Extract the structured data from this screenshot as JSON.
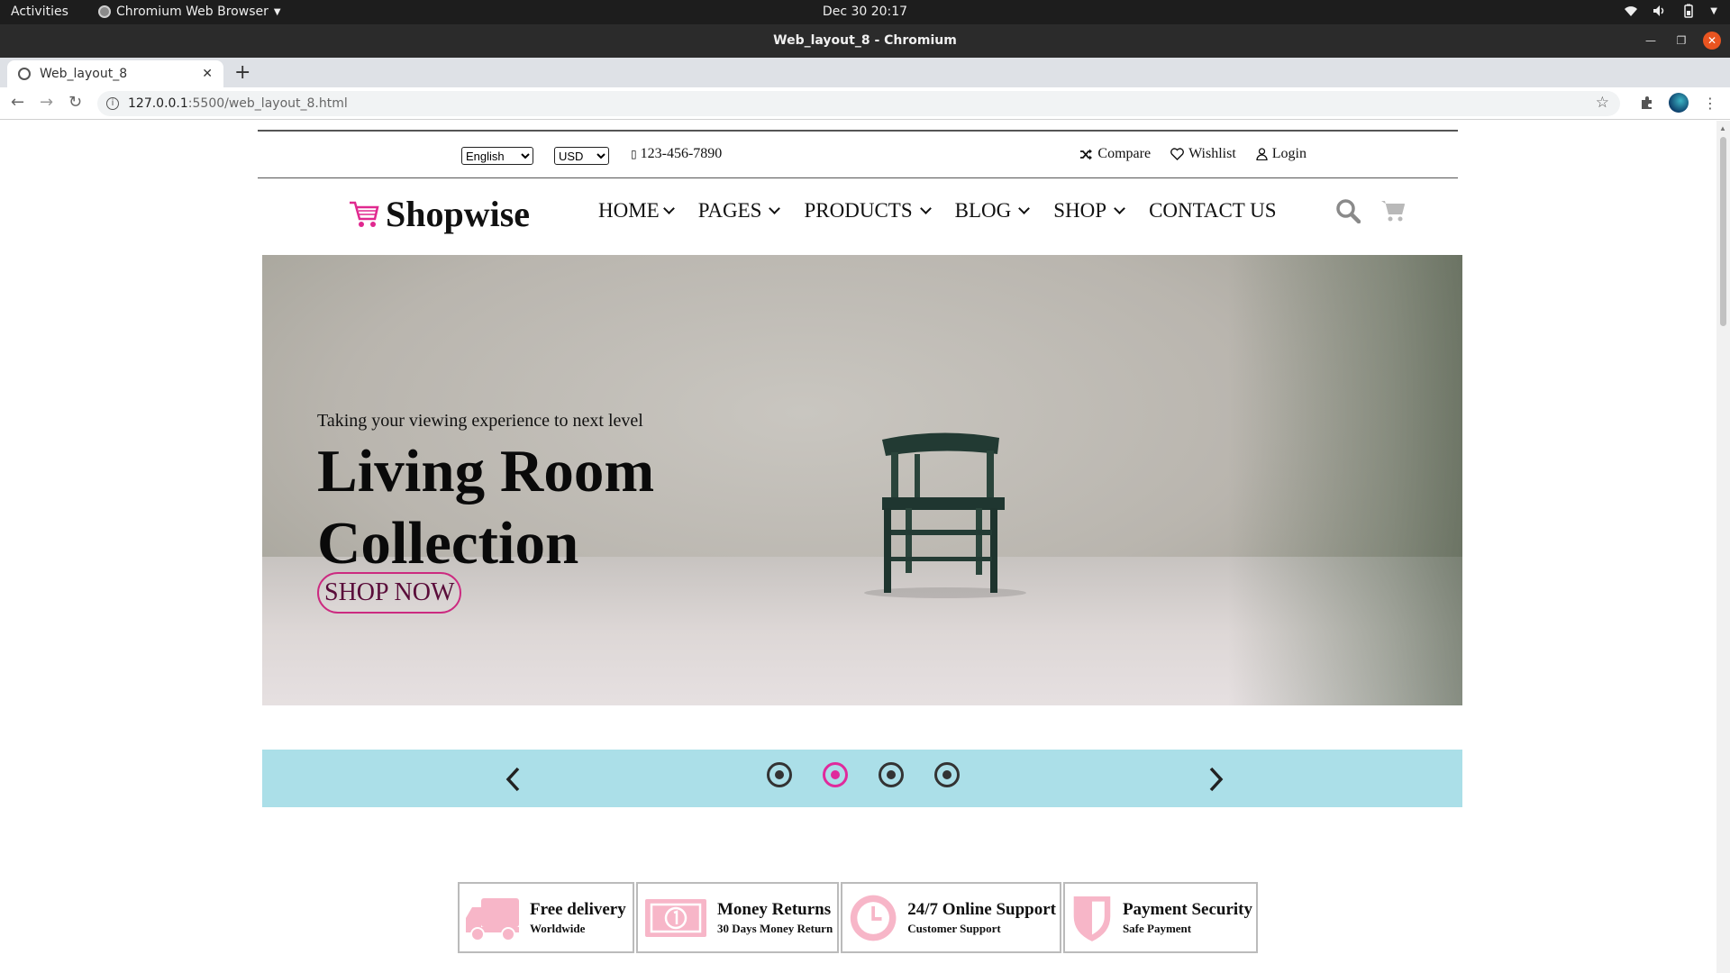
{
  "os": {
    "activities": "Activities",
    "app_name": "Chromium Web Browser",
    "datetime": "Dec 30  20:17"
  },
  "browser": {
    "window_title": "Web_layout_8 - Chromium",
    "tab_title": "Web_layout_8",
    "url_host": "127.0.0.1",
    "url_rest": ":5500/web_layout_8.html"
  },
  "topbar": {
    "language": "English",
    "currency": "USD",
    "phone": "123-456-7890",
    "compare": "Compare",
    "wishlist": "Wishlist",
    "login": "Login"
  },
  "header": {
    "logo": "Shopwise",
    "logo_color": "#e0288f",
    "menu": [
      {
        "label": "HOME"
      },
      {
        "label": "PAGES"
      },
      {
        "label": "PRODUCTS"
      },
      {
        "label": "BLOG"
      },
      {
        "label": "SHOP"
      },
      {
        "label": "CONTACT US"
      }
    ],
    "icons": [
      "search-icon",
      "cart-icon"
    ]
  },
  "hero": {
    "subtitle": "Taking your viewing experience to next level",
    "title": "Living Room Collection",
    "button": "SHOP NOW"
  },
  "slider": {
    "slide_count": 4,
    "active_index": 1,
    "band_color": "#abdfe8",
    "active_color": "#e02a9c"
  },
  "features": [
    {
      "title": "Free delivery",
      "subtitle": "Worldwide",
      "icon": "truck-icon"
    },
    {
      "title": "Money Returns",
      "subtitle": "30 Days Money Return",
      "icon": "money-icon"
    },
    {
      "title": "24/7 Online Support",
      "subtitle": "Customer Support",
      "icon": "clock-icon"
    },
    {
      "title": "Payment Security",
      "subtitle": "Safe Payment",
      "icon": "shield-icon"
    }
  ],
  "feature_icon_color": "#f7b6c8"
}
